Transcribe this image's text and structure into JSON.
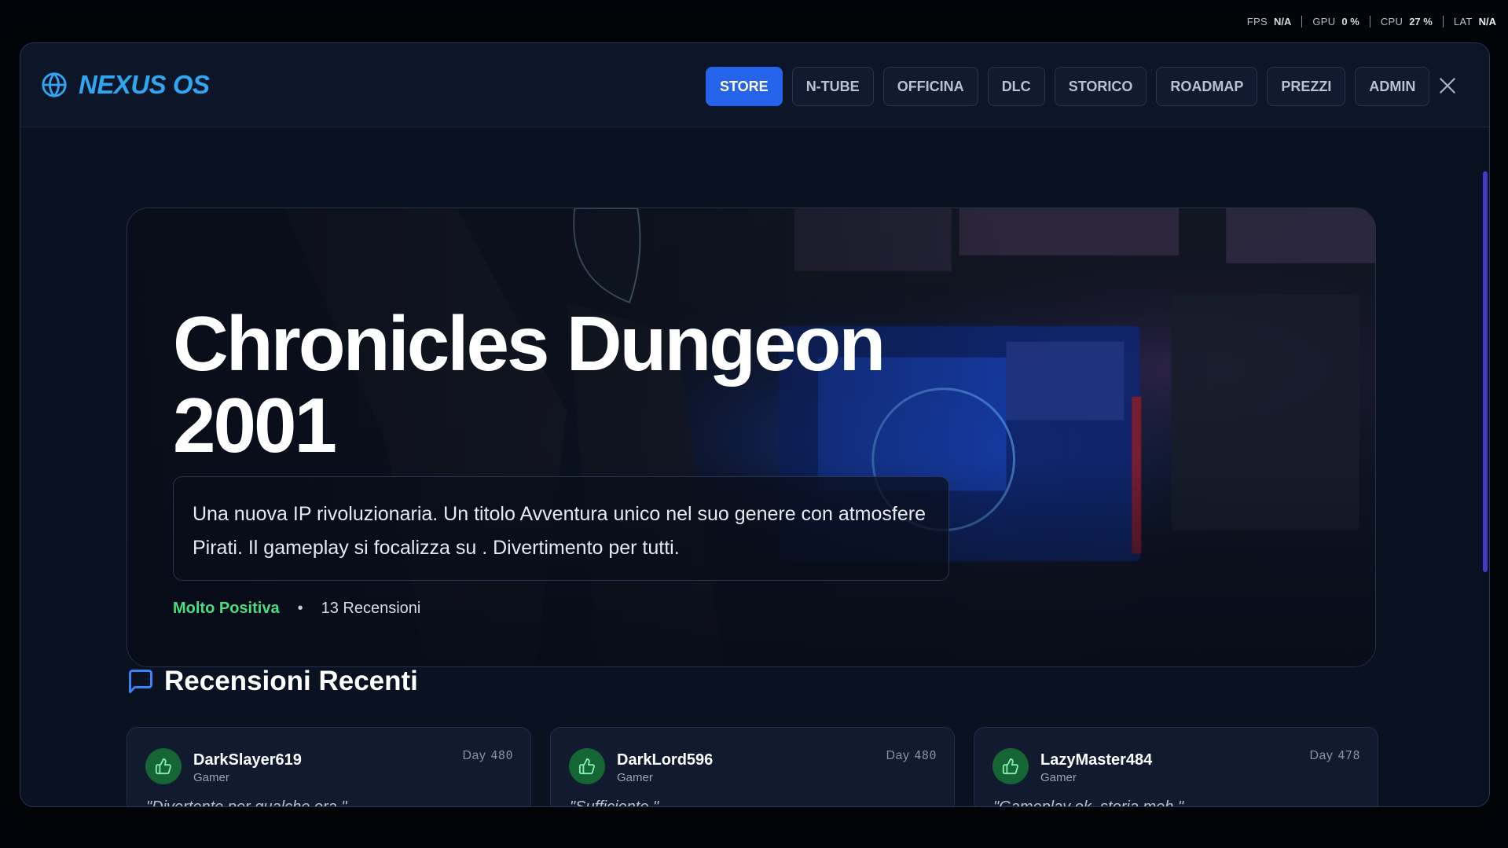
{
  "system": {
    "stats": [
      {
        "label": "FPS",
        "value": "N/A"
      },
      {
        "label": "GPU",
        "value": "0 %"
      },
      {
        "label": "CPU",
        "value": "27 %"
      },
      {
        "label": "LAT",
        "value": "N/A"
      }
    ]
  },
  "app": {
    "name": "NEXUS OS"
  },
  "nav": {
    "tabs": [
      "STORE",
      "N-TUBE",
      "OFFICINA",
      "DLC",
      "STORICO",
      "ROADMAP",
      "PREZZI",
      "ADMIN"
    ],
    "active": "STORE"
  },
  "hero": {
    "title": "Chronicles Dungeon 2001",
    "description": "Una nuova IP rivoluzionaria. Un titolo Avventura unico nel suo genere con atmosfere Pirati. Il gameplay si focalizza su . Divertimento per tutti.",
    "rating": "Molto Positiva",
    "separator": "•",
    "reviews_count": "13 Recensioni"
  },
  "reviews": {
    "heading": "Recensioni Recenti",
    "items": [
      {
        "user": "DarkSlayer619",
        "role": "Gamer",
        "day_label": "Day",
        "day": "480",
        "quote": "\"Divertente per qualche ora.\""
      },
      {
        "user": "DarkLord596",
        "role": "Gamer",
        "day_label": "Day",
        "day": "480",
        "quote": "\"Sufficiente.\""
      },
      {
        "user": "LazyMaster484",
        "role": "Gamer",
        "day_label": "Day",
        "day": "478",
        "quote": "\"Gameplay ok, storia meh.\""
      }
    ]
  },
  "colors": {
    "accent": "#2563eb",
    "brand": "#2fa6f2",
    "positive": "#4ade80",
    "background": "#0a1121"
  },
  "icons": [
    "globe-icon",
    "close-icon",
    "chat-bubble-icon",
    "thumbs-up-icon"
  ]
}
